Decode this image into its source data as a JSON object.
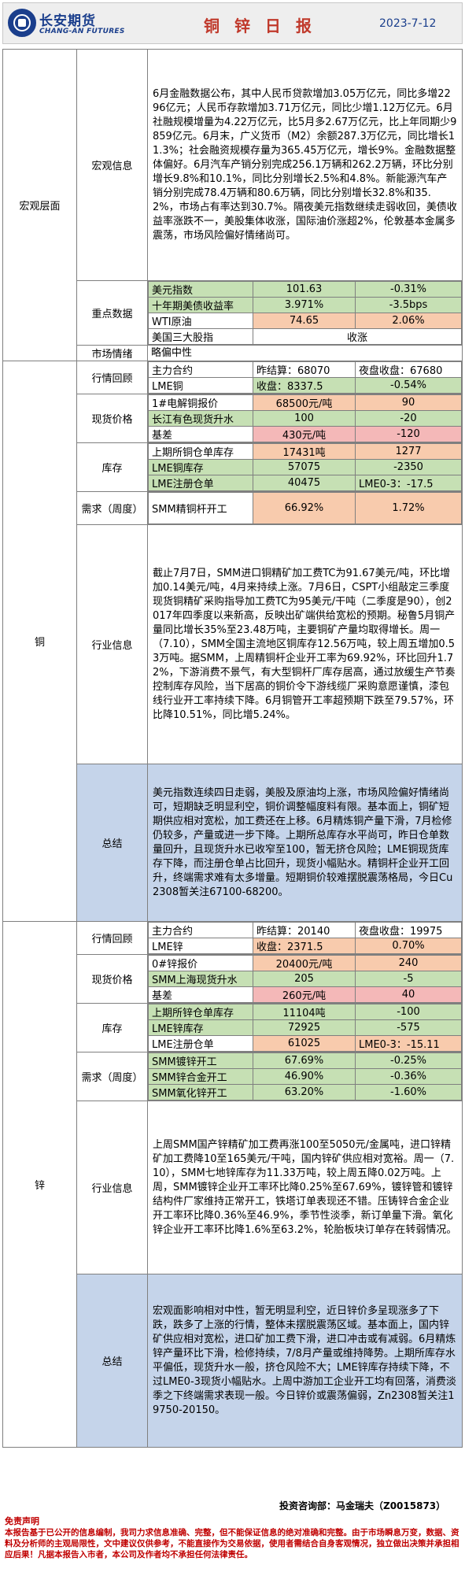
{
  "header": {
    "brand_cn": "长安期货",
    "brand_en": "CHANG-AN FUTURES",
    "title": "铜 锌 日 报",
    "date": "2023-7-12"
  },
  "macro": {
    "section": "宏观层面",
    "info_label": "宏观信息",
    "info_text": "6月金融数据公布，其中人民币贷款增加3.05万亿元，同比多增2296亿元；人民币存款增加3.71万亿元，同比少增1.12万亿元。6月社融规模增量为4.22万亿元，比5月多2.67万亿元，比上年同期少9859亿元。6月末，广义货币（M2）余额287.3万亿元，同比增长11.3%；社会融资规模存量为365.45万亿元，增长9%。金融数据整体偏好。6月汽车产销分别完成256.1万辆和262.2万辆，环比分别增长9.8%和10.1%，同比分别增长2.5%和4.8%。新能源汽车产销分别完成78.4万辆和80.6万辆，同比分别增长32.8%和35.2%，市场占有率达到30.7%。隔夜美元指数继续走弱收回，美债收益率涨跌不一，美股集体收涨，国际油价涨超2%，伦敦基本金属多震荡，市场风险偏好情绪尚可。",
    "data_label": "重点数据",
    "rows": [
      {
        "k": "美元指数",
        "v1": "101.63",
        "v2": "-0.31%"
      },
      {
        "k": "十年期美债收益率",
        "v1": "3.971%",
        "v2": "-3.5bps"
      },
      {
        "k": "WTI原油",
        "v1": "74.65",
        "v2": "2.06%"
      },
      {
        "k": "美国三大股指",
        "v1": "收涨",
        "v2": ""
      }
    ],
    "sentiment_label": "市场情绪",
    "sentiment_value": "略偏中性"
  },
  "copper": {
    "section": "铜",
    "review_label": "行情回顾",
    "review_rows": [
      {
        "k": "主力合约",
        "v1": "昨结算：68070",
        "v2": "夜盘收盘：67680"
      },
      {
        "k": "LME铜",
        "v1": "收盘：8337.5",
        "v2": "-0.54%"
      }
    ],
    "spot_label": "现货价格",
    "spot_rows": [
      {
        "k": "1#电解铜报价",
        "v1": "68500元/吨",
        "v2": "90"
      },
      {
        "k": "长江有色现货升水",
        "v1": "100",
        "v2": "-20"
      },
      {
        "k": "基差",
        "v1": "430元/吨",
        "v2": "-120"
      }
    ],
    "inv_label": "库存",
    "inv_rows": [
      {
        "k": "上期所铜仓单库存",
        "v1": "17431吨",
        "v2": "1277"
      },
      {
        "k": "LME铜库存",
        "v1": "57075",
        "v2": "-2350"
      },
      {
        "k": "LME注册仓单",
        "v1": "40475",
        "v2": "LME0-3：-17.5"
      }
    ],
    "demand_label": "需求（周度）",
    "demand_rows": [
      {
        "k": "SMM精铜杆开工",
        "v1": "66.92%",
        "v2": "1.72%"
      }
    ],
    "industry_label": "行业信息",
    "industry_text": "截止7月7日，SMM进口铜精矿加工费TC为91.67美元/吨，环比增加0.14美元/吨，4月来持续上涨。7月6日，CSPT小组敲定三季度现货铜精矿采购指导加工费TC为95美元/干吨（二季度是90），创2017年四季度以来新高，反映出矿端供给宽松的预期。秘鲁5月铜产量同比增长35%至23.48万吨，主要铜矿产量均取得增长。周一（7.10），SMM全国主流地区铜库存12.56万吨，较上周五增加0.53万吨。据SMM，上周精铜杆企业开工率为69.92%，环比回升1.72%，下游消费不景气，有大型铜杆厂库存居高，通过放缓生产节奏控制库存风险，当下居高的铜价令下游线缆厂采购意愿谨慎，漆包线行业开工率持续下降。6月铜管开工率超预期下跌至79.57%，环比降10.51%，同比增5.24%。",
    "summary_label": "总结",
    "summary_text": "美元指数连续四日走弱，美股及原油均上涨，市场风险偏好情绪尚可，短期缺乏明显利空，铜价调整幅度料有限。基本面上，铜矿短期供应相对宽松，加工费还在上移。6月精炼铜产量下滑，7月检修仍较多，产量或进一步下降。上期所总库存水平尚可，昨日仓单数量回升，且现货升水已收窄至100，暂无挤仓风险；LME铜现货库存下降，而注册仓单占比回升，现货小幅贴水。精铜杆企业开工回升，终端需求难有太多增量。短期铜价较难摆脱震荡格局，今日Cu2308暂关注67100-68200。"
  },
  "zinc": {
    "section": "锌",
    "review_label": "行情回顾",
    "review_rows": [
      {
        "k": "主力合约",
        "v1": "昨结算：20140",
        "v2": "夜盘收盘：19975"
      },
      {
        "k": "LME锌",
        "v1": "收盘：2371.5",
        "v2": "0.70%"
      }
    ],
    "spot_label": "现货价格",
    "spot_rows": [
      {
        "k": "0#锌报价",
        "v1": "20400元/吨",
        "v2": "240"
      },
      {
        "k": "SMM上海现货升水",
        "v1": "205",
        "v2": "-5"
      },
      {
        "k": "基差",
        "v1": "260元/吨",
        "v2": "40"
      }
    ],
    "inv_label": "库存",
    "inv_rows": [
      {
        "k": "上期所锌仓单库存",
        "v1": "11104吨",
        "v2": "-100"
      },
      {
        "k": "LME锌库存",
        "v1": "72925",
        "v2": "-575"
      },
      {
        "k": "LME注册仓单",
        "v1": "61025",
        "v2": "LME0-3：-15.11"
      }
    ],
    "demand_label": "需求（周度）",
    "demand_rows": [
      {
        "k": "SMM镀锌开工",
        "v1": "67.69%",
        "v2": "-0.25%"
      },
      {
        "k": "SMM锌合金开工",
        "v1": "46.90%",
        "v2": "-0.36%"
      },
      {
        "k": "SMM氧化锌开工",
        "v1": "63.20%",
        "v2": "-1.60%"
      }
    ],
    "industry_label": "行业信息",
    "industry_text": "上周SMM国产锌精矿加工费再涨100至5050元/金属吨，进口锌精矿加工费降10至165美元/干吨，国内锌矿供应相对宽裕。周一（7.10），SMM七地锌库存为11.33万吨，较上周五降0.02万吨。上周，SMM镀锌企业开工率环比降0.25%至67.69%，镀锌管和镀锌结构件厂家维持正常开工，铁塔订单表现还不错。压铸锌合金企业开工率环比降0.36%至46.9%，季节性淡季，新订单量下滑。氧化锌企业开工率环比降1.6%至63.2%，轮胎板块订单存在转弱情况。",
    "summary_label": "总结",
    "summary_text": "宏观面影响相对中性，暂无明显利空，近日锌价多呈现涨多了下跌，跌多了上涨的行情，整体未摆脱震荡区域。基本面上，国内锌矿供应相对宽松，进口矿加工费下滑，进口冲击或有减弱。6月精炼锌产量环比下滑，检修持续，7/8月产量或维持降势。上期所库存水平偏低，现货升水一般，挤仓风险不大；LME锌库存持续下降，不过LME0-3现货小幅贴水。上周中游加工企业开工均有回落，消费淡季之下终端需求表现一般。今日锌价或震荡偏弱，Zn2308暂关注19750-20150。"
  },
  "footer": {
    "source": "投资咨询部：马金瑞夫（Z0015873）",
    "disclaimer_title": "免责声明",
    "disclaimer_text": "本报告基于已公开的信息编制，我司力求信息准确、完整，但不能保证信息的绝对准确和完整。由于市场瞬息万变，数据、资料及分析师的主观局限性，文中建议仅供参考，不能直接作为交易依据，使用者需结合自身客观情况，独立做出决策并承担相应后果！凡据本报告入市者，本公司及作者均不承担任何法律责任。"
  },
  "colors": {
    "positive_green": "#c6e0b4",
    "highlight_orange": "#f8cbad",
    "basis_pink": "#f4b8b8",
    "summary_blue": "#c5d4ea",
    "brand_blue": "#1a3e8c",
    "title_red": "#c0392b"
  }
}
